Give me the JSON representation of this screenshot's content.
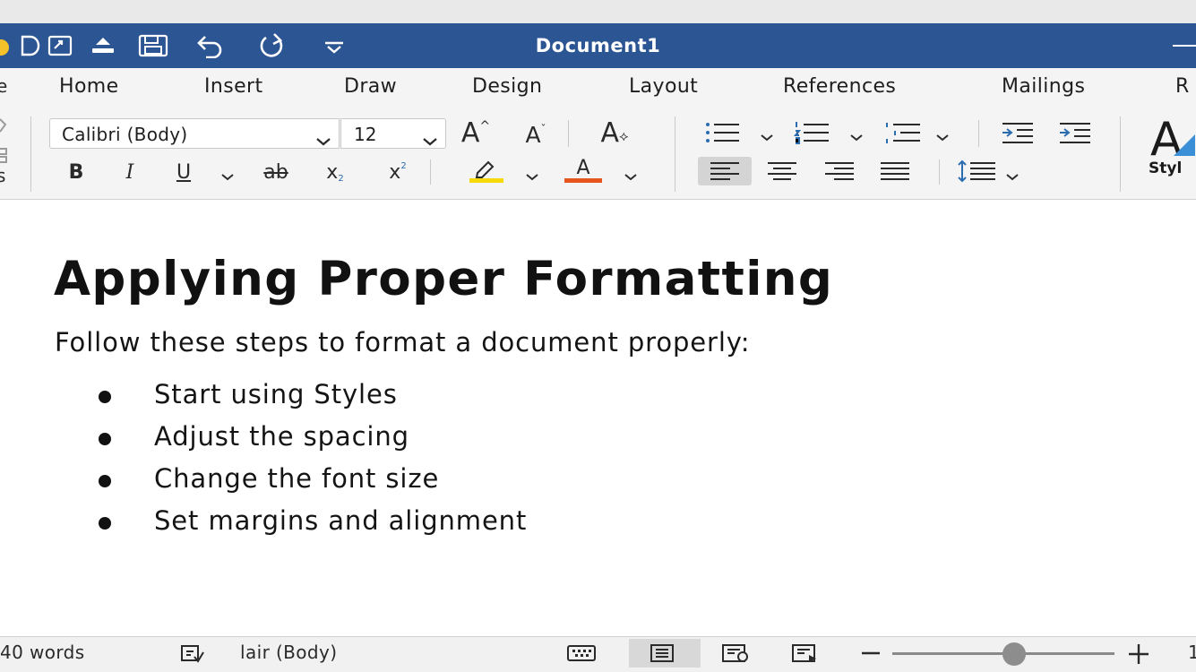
{
  "window": {
    "title": "Document1"
  },
  "quick_access": {
    "icons": [
      "autosave-icon",
      "new-document-icon",
      "open-file-icon",
      "upload-icon",
      "save-icon",
      "undo-icon",
      "redo-icon",
      "customize-dropdown-icon"
    ]
  },
  "tabs": [
    {
      "label": "Home"
    },
    {
      "label": "Insert"
    },
    {
      "label": "Draw"
    },
    {
      "label": "Design"
    },
    {
      "label": "Layout"
    },
    {
      "label": "References"
    },
    {
      "label": "Mailings"
    },
    {
      "label": "R"
    }
  ],
  "left_stubs": {
    "tab": "e",
    "ribbon_bottom": "s"
  },
  "ribbon": {
    "font_name": "Calibri (Body)",
    "font_size": "12",
    "styles_glyph": "A",
    "styles_label": "Styl",
    "highlight_color": "#f5d90a",
    "font_color": "#e8561f",
    "glyphs": {
      "grow": "A",
      "shrink": "A",
      "clear": "A",
      "bold": "B",
      "italic": "I",
      "underline": "U",
      "strike": "ab",
      "sub": "x",
      "sup": "x",
      "font_color_letter": "A"
    }
  },
  "document": {
    "title": "Applying Proper Formatting",
    "intro": "Follow these steps to format a document properly:",
    "bullets": [
      "Start using Styles",
      "Adjust the spacing",
      "Change the font size",
      "Set margins and alignment"
    ]
  },
  "statusbar": {
    "word_count": "40 words",
    "language": "lair (Body)",
    "zoom_fraction": 0.55,
    "zoom_text_stub": "1"
  },
  "colors": {
    "titlebar": "#2c5593",
    "accent_blue": "#2b6cb0"
  }
}
